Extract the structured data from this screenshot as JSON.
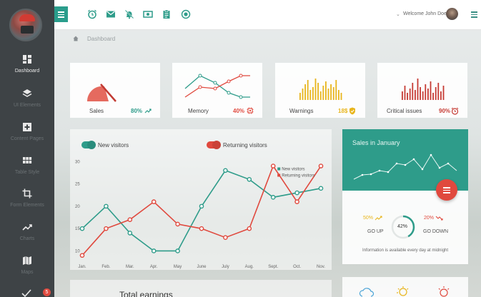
{
  "sidebar": {
    "items": [
      {
        "label": "Dashboard",
        "icon": "dashboard-icon",
        "active": true
      },
      {
        "label": "UI Elements",
        "icon": "layers-icon"
      },
      {
        "label": "Content Pages",
        "icon": "plus-square-icon"
      },
      {
        "label": "Table Style",
        "icon": "grid-icon"
      },
      {
        "label": "Form Elements",
        "icon": "crop-icon"
      },
      {
        "label": "Charts",
        "icon": "trending-up-icon"
      },
      {
        "label": "Maps",
        "icon": "map-icon"
      }
    ],
    "badge": "5"
  },
  "topbar": {
    "welcome": "Welcome John Doe",
    "icons": [
      "alarm-icon",
      "mail-icon",
      "bell-off-icon",
      "money-icon",
      "clipboard-icon",
      "radio-icon"
    ]
  },
  "breadcrumb": "Dashboard",
  "cards": [
    {
      "name": "Sales",
      "value": "80%",
      "color": "#2e9c8a",
      "icon": "trending-up-icon"
    },
    {
      "name": "Memory",
      "value": "40%",
      "color": "#e0493e",
      "icon": "chip-icon"
    },
    {
      "name": "Warnings",
      "value": "18$",
      "color": "#e8b51c",
      "icon": "shield-icon"
    },
    {
      "name": "Critical issues",
      "value": "90%",
      "color": "#c63b34",
      "icon": "alarm-icon"
    }
  ],
  "chart": {
    "legend": [
      "New visitors",
      "Returning visitors"
    ],
    "inner_legend": [
      "New visitors",
      "Returning visitors"
    ]
  },
  "chart_data": {
    "type": "line",
    "categories": [
      "Jan.",
      "Feb.",
      "Mar.",
      "Apr.",
      "May",
      "June",
      "July",
      "Aug.",
      "Sept.",
      "Oct.",
      "Nov."
    ],
    "series": [
      {
        "name": "New visitors",
        "color": "#2e9c8a",
        "values": [
          15,
          20,
          14,
          10,
          10,
          20,
          28,
          26,
          22,
          23,
          24
        ]
      },
      {
        "name": "Returning visitors",
        "color": "#e0493e",
        "values": [
          9,
          15,
          17,
          21,
          16,
          15,
          13,
          15,
          29,
          21,
          29
        ]
      }
    ],
    "yticks": [
      10,
      15,
      20,
      25,
      30
    ],
    "ylim": [
      8,
      31
    ],
    "grid": false,
    "legend_position": "top-left"
  },
  "sales_panel": {
    "title": "Sales in January",
    "go_up_value": "50%",
    "go_up_label": "GO UP",
    "center_value": "42%",
    "go_down_value": "20%",
    "go_down_label": "GO DOWN",
    "footer": "Information is available every day at midnight"
  },
  "bottom_title": "Total earnings"
}
